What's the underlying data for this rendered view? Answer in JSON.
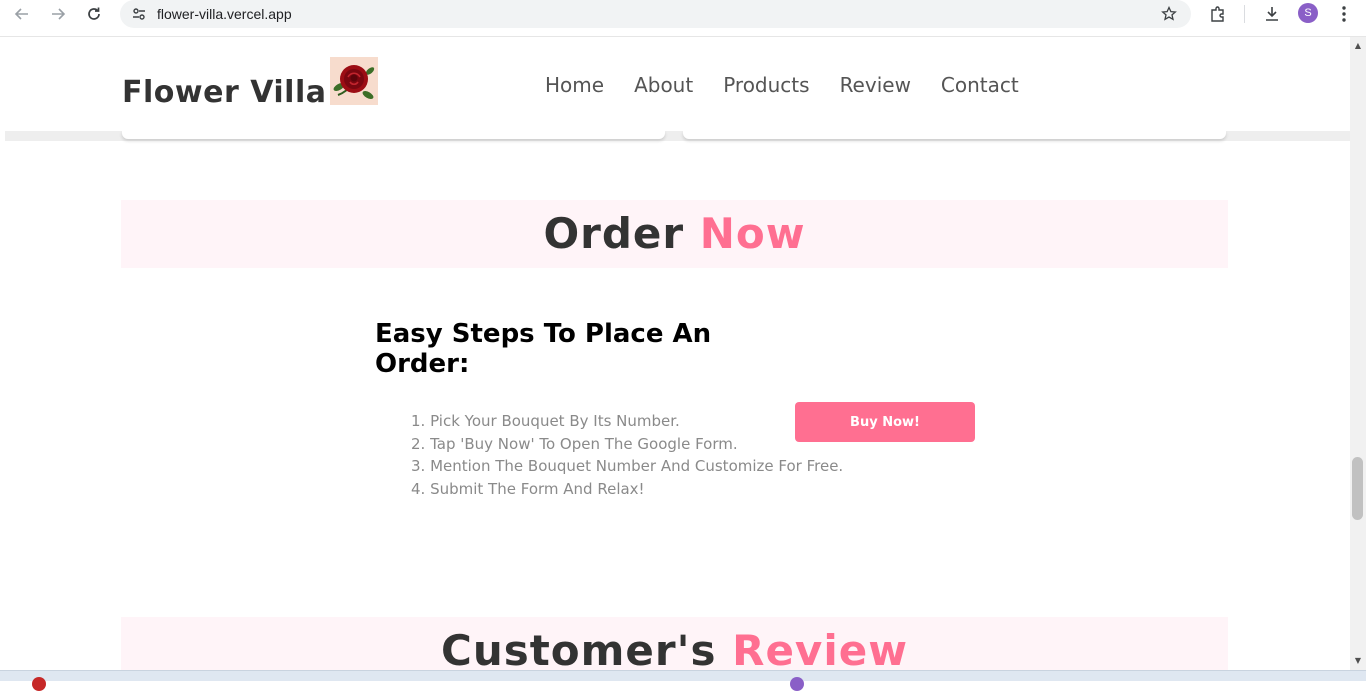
{
  "browser": {
    "url": "flower-villa.vercel.app",
    "profile_initial": "S",
    "icons": [
      "back-icon",
      "forward-icon",
      "reload-icon",
      "site-settings-icon",
      "bookmark-star-icon",
      "extensions-icon",
      "download-icon",
      "menu-dots-icon"
    ]
  },
  "header": {
    "logo_text": "Flower Villa",
    "logo_image": "rose-logo",
    "nav": [
      "Home",
      "About",
      "Products",
      "Review",
      "Contact"
    ]
  },
  "order": {
    "heading_main": "Order",
    "heading_accent": "Now",
    "steps_title": "Easy Steps To Place An Order:",
    "steps": [
      "1. Pick Your Bouquet By Its Number.",
      "2. Tap 'Buy Now' To Open The Google Form.",
      "3. Mention The Bouquet Number And Customize For Free.",
      "4. Submit The Form And Relax!"
    ],
    "button_label": "Buy Now!"
  },
  "review": {
    "heading_main": "Customer's",
    "heading_accent": "Review"
  },
  "colors": {
    "accent": "#ff6f91",
    "heading_band": "#fff4f8",
    "text_dark": "#333333",
    "step_text": "#8a8a8a"
  }
}
